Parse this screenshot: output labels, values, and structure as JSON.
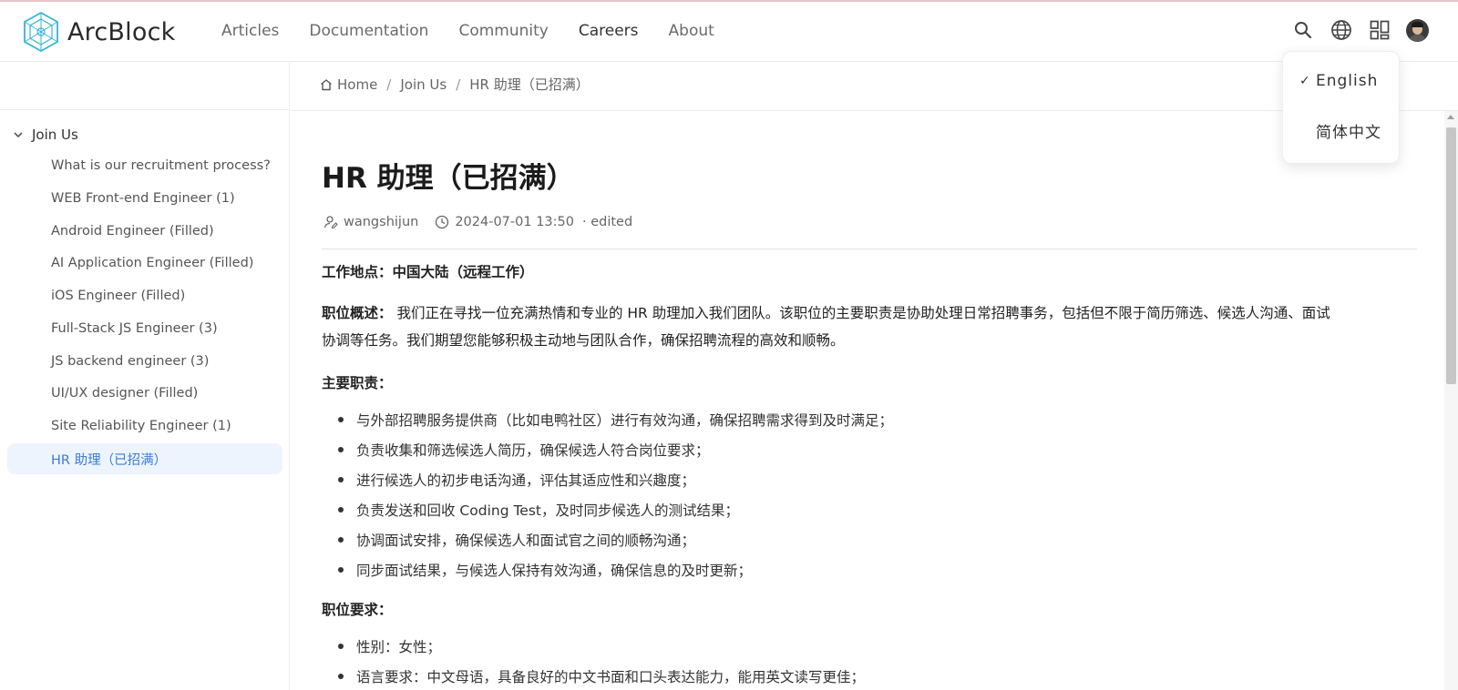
{
  "brand": {
    "name": "ArcBlock"
  },
  "nav": {
    "items": [
      {
        "label": "Articles"
      },
      {
        "label": "Documentation"
      },
      {
        "label": "Community"
      },
      {
        "label": "Careers"
      },
      {
        "label": "About"
      }
    ],
    "active": "Careers"
  },
  "header_icons": [
    "search-icon",
    "globe-icon",
    "apps-grid-icon",
    "user-avatar"
  ],
  "language_menu": {
    "options": [
      {
        "label": "English",
        "selected": true
      },
      {
        "label": "简体中文",
        "selected": false
      }
    ]
  },
  "sidebar": {
    "group": "Join Us",
    "items": [
      {
        "label": "What is our recruitment process?"
      },
      {
        "label": "WEB Front-end Engineer (1)"
      },
      {
        "label": "Android Engineer (Filled)"
      },
      {
        "label": "AI Application Engineer (Filled)"
      },
      {
        "label": "iOS Engineer (Filled)"
      },
      {
        "label": "Full-Stack JS Engineer (3)"
      },
      {
        "label": "JS backend engineer (3)"
      },
      {
        "label": "UI/UX designer (Filled)"
      },
      {
        "label": "Site Reliability Engineer (1)"
      },
      {
        "label": "HR 助理（已招满）"
      }
    ],
    "active_index": 9
  },
  "breadcrumb": {
    "home": "Home",
    "section": "Join Us",
    "current": "HR 助理（已招满）",
    "sep": "/"
  },
  "article": {
    "title": "HR 助理（已招满）",
    "author": "wangshijun",
    "datetime": "2024-07-01 13:50",
    "edited": "· edited",
    "location_label": "工作地点：",
    "location_value": "中国大陆（远程工作）",
    "overview_label": "职位概述：",
    "overview_line1": "我们正在寻找一位充满热情和专业的 HR 助理加入我们团队。该职位的主要职责是协助处理日常招聘事务，包括但不限于简历筛选、候选人沟通、面试",
    "overview_line2": "协调等任务。我们期望您能够积极主动地与团队合作，确保招聘流程的高效和顺畅。",
    "duties_label": "主要职责：",
    "duties": [
      "与外部招聘服务提供商（比如电鸭社区）进行有效沟通，确保招聘需求得到及时满足；",
      "负责收集和筛选候选人简历，确保候选人符合岗位要求；",
      "进行候选人的初步电话沟通，评估其适应性和兴趣度；",
      "负责发送和回收 Coding Test，及时同步候选人的测试结果；",
      "协调面试安排，确保候选人和面试官之间的顺畅沟通；",
      "同步面试结果，与候选人保持有效沟通，确保信息的及时更新；"
    ],
    "requirements_label": "职位要求：",
    "requirements": [
      "性别：女性；",
      "语言要求：中文母语，具备良好的中文书面和口头表达能力，能用英文读写更佳；"
    ]
  }
}
